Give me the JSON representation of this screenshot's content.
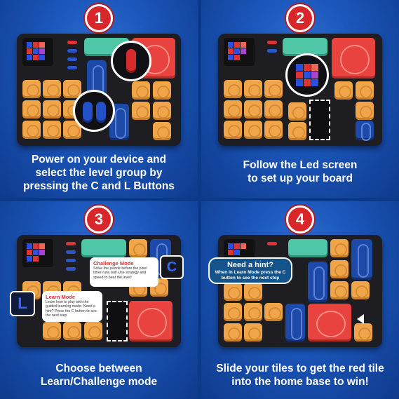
{
  "steps": [
    {
      "number": "1",
      "caption_lines": [
        "Power on your device and",
        "select the level group by",
        "pressing the C and L Buttons"
      ]
    },
    {
      "number": "2",
      "caption_lines": [
        "Follow the Led screen",
        "to set up your board"
      ]
    },
    {
      "number": "3",
      "caption_lines": [
        "Choose between",
        "Learn/Challenge mode"
      ]
    },
    {
      "number": "4",
      "caption_lines": [
        "Slide your tiles to get the red tile",
        "into the home base to win!"
      ]
    }
  ],
  "challenge_callout": {
    "title": "Challenge Mode",
    "body": "Solve the puzzle before the pixel timer runs out! Use strategy and speed to beat the level!"
  },
  "learn_callout": {
    "title": "Learn Mode",
    "body": "Learn how to play with the guided learning mode. Need a hint? Press the C button to see the next step",
    "cube_letter": "L"
  },
  "challenge_cube_letter": "C",
  "hint_bubble": {
    "title": "Need a hint?",
    "body": "When in Learn Mode press the C button to see the next step"
  },
  "colors": {
    "background_blue": "#1a55b8",
    "badge_red": "#d9262b",
    "tile_yellow": "#f0a648",
    "tile_blue": "#1d4aa8",
    "tile_green": "#4fc6a6",
    "tile_red": "#e8433f"
  }
}
